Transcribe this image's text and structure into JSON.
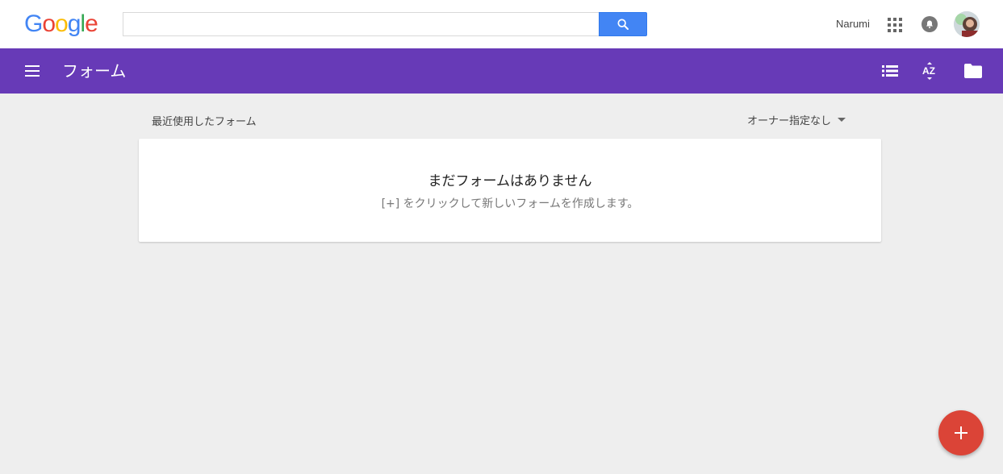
{
  "google_bar": {
    "logo_letters": [
      {
        "char": "G",
        "color": "#4285f4"
      },
      {
        "char": "o",
        "color": "#ea4335"
      },
      {
        "char": "o",
        "color": "#fbbc05"
      },
      {
        "char": "g",
        "color": "#4285f4"
      },
      {
        "char": "l",
        "color": "#34a853"
      },
      {
        "char": "e",
        "color": "#ea4335"
      }
    ],
    "search": {
      "value": "",
      "placeholder": ""
    },
    "user_name": "Narumi"
  },
  "app_bar": {
    "title": "フォーム",
    "color": "#673ab7",
    "icons": [
      "list-view-icon",
      "sort-az-icon",
      "folder-icon"
    ]
  },
  "content": {
    "section_label": "最近使用したフォーム",
    "owner_filter": "オーナー指定なし",
    "empty_state": {
      "title": "まだフォームはありません",
      "subtitle": "[+] をクリックして新しいフォームを作成します。"
    }
  },
  "fab": {
    "label": "+",
    "color": "#db4437"
  }
}
